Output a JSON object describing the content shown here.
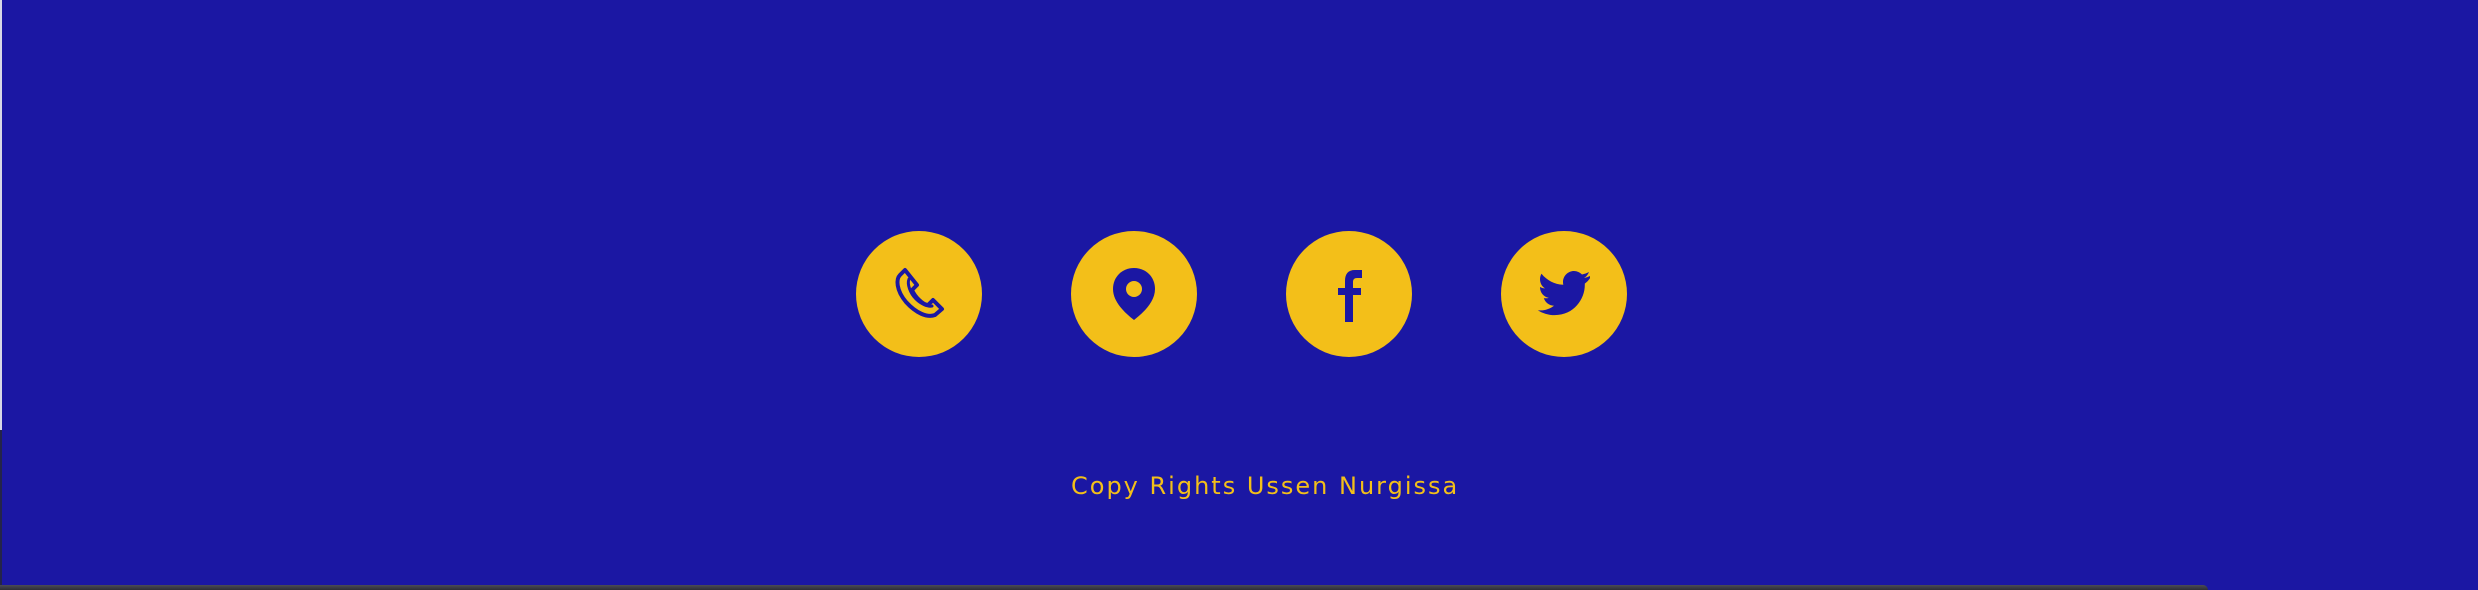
{
  "colors": {
    "background": "#1b17a3",
    "accent": "#f3bf19"
  },
  "social_links": [
    {
      "name": "phone",
      "icon": "phone-icon"
    },
    {
      "name": "location",
      "icon": "location-pin-icon"
    },
    {
      "name": "facebook",
      "icon": "facebook-icon"
    },
    {
      "name": "twitter",
      "icon": "twitter-icon"
    }
  ],
  "footer": {
    "copyright": "Copy Rights Ussen Nurgissa"
  }
}
